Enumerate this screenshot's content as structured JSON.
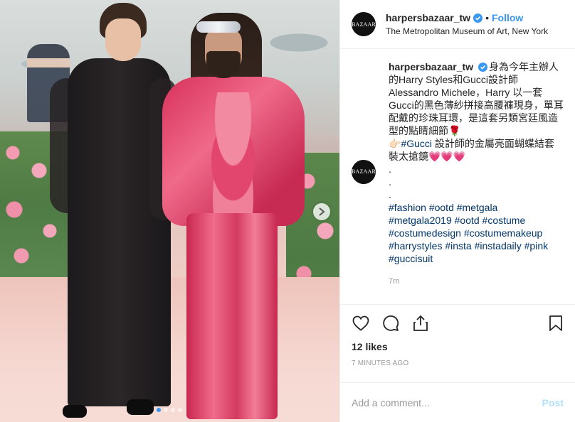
{
  "header": {
    "avatar_text": "BAZAAR",
    "username": "harpersbazaar_tw",
    "bullet": "•",
    "follow_label": "Follow",
    "location": "The Metropolitan Museum of Art, New York"
  },
  "caption": {
    "username": "harpersbazaar_tw",
    "lines": [
      "身為今年主辦人",
      "的Harry Styles和Gucci設計師",
      "Alessandro Michele，Harry 以一套",
      "Gucci的黑色薄紗拼接高腰褲現身，單耳",
      "配戴的珍珠耳環，是這套另類宮廷風造",
      "型的點睛細節🌹",
      "👉🏻",
      "#Gucci",
      " 設計師的金屬亮面蝴蝶結套",
      "裝太搶鏡💗💗💗"
    ],
    "dots": [
      ".",
      ".",
      "."
    ],
    "hashtag_lines": [
      "#fashion #ootd #metgala",
      "#metgala2019 #ootd #costume",
      "#costumedesign #costumemakeup",
      "#harrystyles #insta #instadaily #pink",
      "#guccisuit"
    ],
    "time": "7m"
  },
  "actions": {
    "like_icon": "heart-outline-icon",
    "comment_icon": "speech-bubble-icon",
    "share_icon": "share-icon",
    "save_icon": "bookmark-icon"
  },
  "likes": "12 likes",
  "timestamp": "7 MINUTES AGO",
  "comment_box": {
    "placeholder": "Add a comment...",
    "post_label": "Post"
  },
  "carousel": {
    "slides_count": 4,
    "active_index": 0,
    "next_icon": "chevron-right-icon"
  },
  "colors": {
    "accent": "#3897f0",
    "hashtag": "#003569",
    "muted": "#999999",
    "post_disabled": "#b2dffc"
  }
}
